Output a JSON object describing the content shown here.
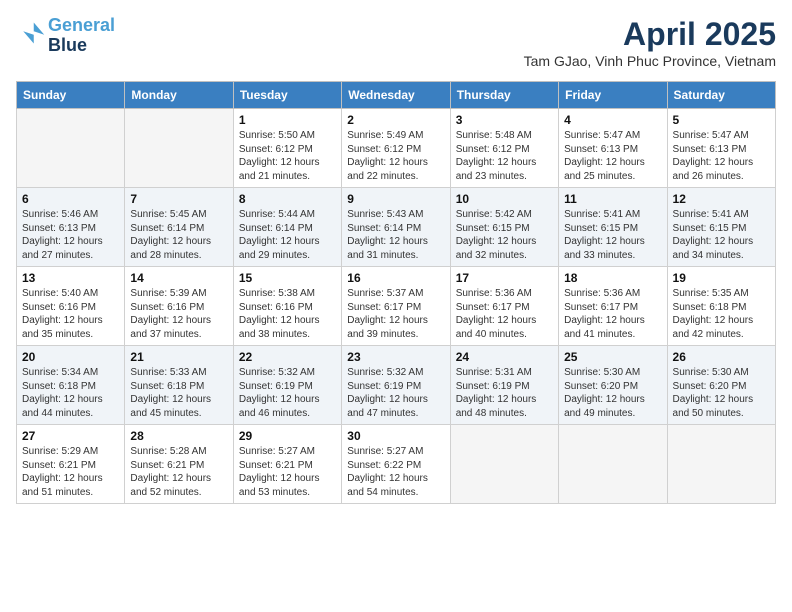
{
  "header": {
    "logo_line1": "General",
    "logo_line2": "Blue",
    "month_year": "April 2025",
    "location": "Tam GJao, Vinh Phuc Province, Vietnam"
  },
  "weekdays": [
    "Sunday",
    "Monday",
    "Tuesday",
    "Wednesday",
    "Thursday",
    "Friday",
    "Saturday"
  ],
  "weeks": [
    [
      {
        "day": "",
        "info": ""
      },
      {
        "day": "",
        "info": ""
      },
      {
        "day": "1",
        "info": "Sunrise: 5:50 AM\nSunset: 6:12 PM\nDaylight: 12 hours and 21 minutes."
      },
      {
        "day": "2",
        "info": "Sunrise: 5:49 AM\nSunset: 6:12 PM\nDaylight: 12 hours and 22 minutes."
      },
      {
        "day": "3",
        "info": "Sunrise: 5:48 AM\nSunset: 6:12 PM\nDaylight: 12 hours and 23 minutes."
      },
      {
        "day": "4",
        "info": "Sunrise: 5:47 AM\nSunset: 6:13 PM\nDaylight: 12 hours and 25 minutes."
      },
      {
        "day": "5",
        "info": "Sunrise: 5:47 AM\nSunset: 6:13 PM\nDaylight: 12 hours and 26 minutes."
      }
    ],
    [
      {
        "day": "6",
        "info": "Sunrise: 5:46 AM\nSunset: 6:13 PM\nDaylight: 12 hours and 27 minutes."
      },
      {
        "day": "7",
        "info": "Sunrise: 5:45 AM\nSunset: 6:14 PM\nDaylight: 12 hours and 28 minutes."
      },
      {
        "day": "8",
        "info": "Sunrise: 5:44 AM\nSunset: 6:14 PM\nDaylight: 12 hours and 29 minutes."
      },
      {
        "day": "9",
        "info": "Sunrise: 5:43 AM\nSunset: 6:14 PM\nDaylight: 12 hours and 31 minutes."
      },
      {
        "day": "10",
        "info": "Sunrise: 5:42 AM\nSunset: 6:15 PM\nDaylight: 12 hours and 32 minutes."
      },
      {
        "day": "11",
        "info": "Sunrise: 5:41 AM\nSunset: 6:15 PM\nDaylight: 12 hours and 33 minutes."
      },
      {
        "day": "12",
        "info": "Sunrise: 5:41 AM\nSunset: 6:15 PM\nDaylight: 12 hours and 34 minutes."
      }
    ],
    [
      {
        "day": "13",
        "info": "Sunrise: 5:40 AM\nSunset: 6:16 PM\nDaylight: 12 hours and 35 minutes."
      },
      {
        "day": "14",
        "info": "Sunrise: 5:39 AM\nSunset: 6:16 PM\nDaylight: 12 hours and 37 minutes."
      },
      {
        "day": "15",
        "info": "Sunrise: 5:38 AM\nSunset: 6:16 PM\nDaylight: 12 hours and 38 minutes."
      },
      {
        "day": "16",
        "info": "Sunrise: 5:37 AM\nSunset: 6:17 PM\nDaylight: 12 hours and 39 minutes."
      },
      {
        "day": "17",
        "info": "Sunrise: 5:36 AM\nSunset: 6:17 PM\nDaylight: 12 hours and 40 minutes."
      },
      {
        "day": "18",
        "info": "Sunrise: 5:36 AM\nSunset: 6:17 PM\nDaylight: 12 hours and 41 minutes."
      },
      {
        "day": "19",
        "info": "Sunrise: 5:35 AM\nSunset: 6:18 PM\nDaylight: 12 hours and 42 minutes."
      }
    ],
    [
      {
        "day": "20",
        "info": "Sunrise: 5:34 AM\nSunset: 6:18 PM\nDaylight: 12 hours and 44 minutes."
      },
      {
        "day": "21",
        "info": "Sunrise: 5:33 AM\nSunset: 6:18 PM\nDaylight: 12 hours and 45 minutes."
      },
      {
        "day": "22",
        "info": "Sunrise: 5:32 AM\nSunset: 6:19 PM\nDaylight: 12 hours and 46 minutes."
      },
      {
        "day": "23",
        "info": "Sunrise: 5:32 AM\nSunset: 6:19 PM\nDaylight: 12 hours and 47 minutes."
      },
      {
        "day": "24",
        "info": "Sunrise: 5:31 AM\nSunset: 6:19 PM\nDaylight: 12 hours and 48 minutes."
      },
      {
        "day": "25",
        "info": "Sunrise: 5:30 AM\nSunset: 6:20 PM\nDaylight: 12 hours and 49 minutes."
      },
      {
        "day": "26",
        "info": "Sunrise: 5:30 AM\nSunset: 6:20 PM\nDaylight: 12 hours and 50 minutes."
      }
    ],
    [
      {
        "day": "27",
        "info": "Sunrise: 5:29 AM\nSunset: 6:21 PM\nDaylight: 12 hours and 51 minutes."
      },
      {
        "day": "28",
        "info": "Sunrise: 5:28 AM\nSunset: 6:21 PM\nDaylight: 12 hours and 52 minutes."
      },
      {
        "day": "29",
        "info": "Sunrise: 5:27 AM\nSunset: 6:21 PM\nDaylight: 12 hours and 53 minutes."
      },
      {
        "day": "30",
        "info": "Sunrise: 5:27 AM\nSunset: 6:22 PM\nDaylight: 12 hours and 54 minutes."
      },
      {
        "day": "",
        "info": ""
      },
      {
        "day": "",
        "info": ""
      },
      {
        "day": "",
        "info": ""
      }
    ]
  ]
}
